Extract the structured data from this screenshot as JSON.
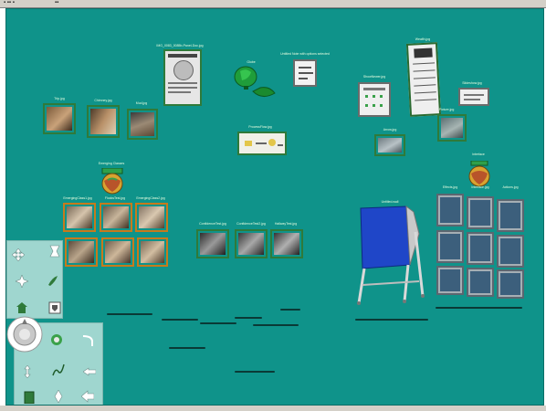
{
  "labels": {
    "doc_panel": "IMG_0083_0085b-Panel-Doc.jpg",
    "globe_top": "Globe",
    "note_top": "Untitled Note with options selected",
    "list_panel": "Wealth.jpg",
    "left_a": "Trip.jpg",
    "left_b": "Chimney.jpg",
    "left_c": "Mud.jpg",
    "diagram": "ProcessFlow.jpg",
    "form_panel": "ShowNewer.jpg",
    "right_small": "Slideshow.jpg",
    "right_mid": "Picture.jpg",
    "right_card": "Arrow.jpg",
    "image_right": "Bendix.jpg",
    "emerging": "Emerging Classes",
    "orange_row1": [
      "EmergingClass1.jpg",
      "FlocksTest.jpg",
      "EmergingClass2.jpg"
    ],
    "mid_row": [
      "ConfidenceTest.jpg",
      "ConfidenceTest2.jpg",
      "HallwayTest.jpg"
    ],
    "globe_right": "Interface",
    "easel": "Untitled.wall",
    "blue_top": [
      "Effects.jpg",
      "Interface.jpg",
      "Actions.jpg"
    ]
  },
  "colors": {
    "desktop": "#0f938a",
    "card_green": "#2f7a3a",
    "card_orange": "#c77a1c",
    "easel_blue": "#1f46c8"
  },
  "toolbar_icons": [
    "move-icon",
    "pan-icon",
    "rotate-icon",
    "paint-icon",
    "home-icon",
    "shield-icon",
    "navigation-disc-icon",
    "target-icon",
    "hook-icon",
    "drag-icon",
    "path-icon",
    "orbit-icon",
    "trash-icon",
    "spray-icon",
    "arrow-target-icon"
  ]
}
